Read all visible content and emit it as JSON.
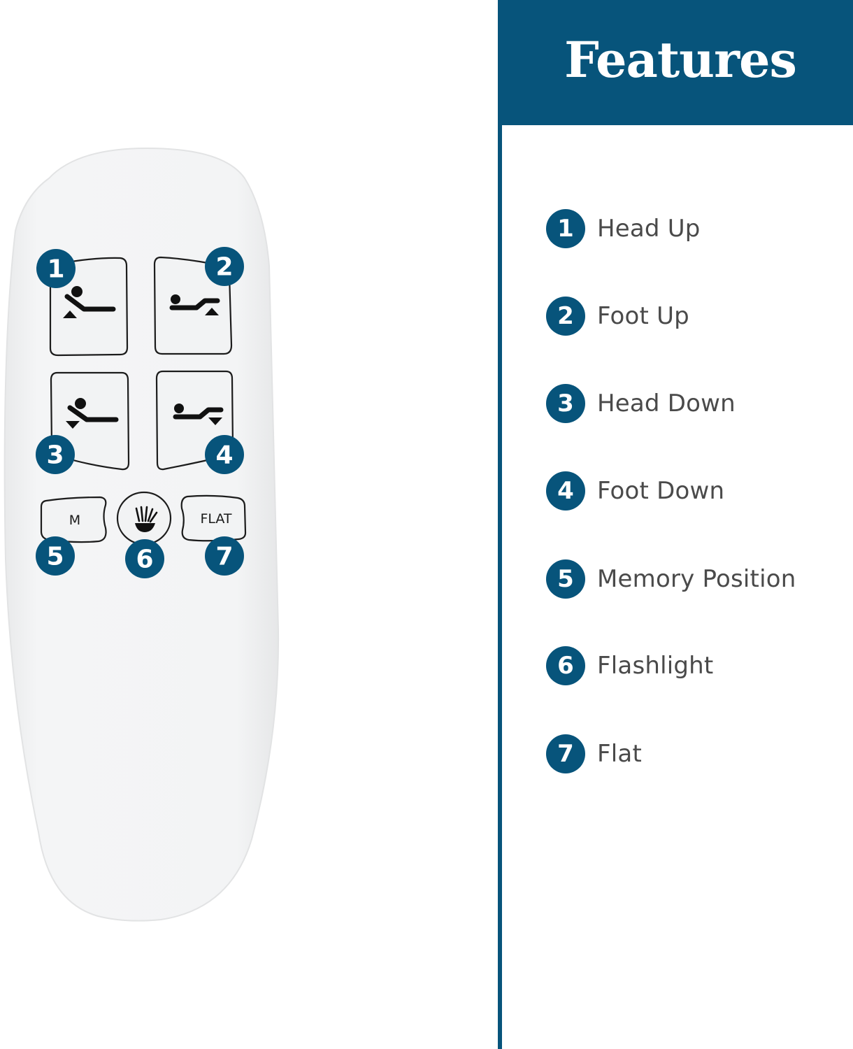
{
  "colors": {
    "brand_blue": "#07547b",
    "label_gray": "#4a4a4a",
    "remote_body": "#f2f3f4"
  },
  "remote": {
    "buttons": [
      {
        "number": "1",
        "icon": "head-up-icon",
        "label": ""
      },
      {
        "number": "2",
        "icon": "foot-up-icon",
        "label": ""
      },
      {
        "number": "3",
        "icon": "head-down-icon",
        "label": ""
      },
      {
        "number": "4",
        "icon": "foot-down-icon",
        "label": ""
      },
      {
        "number": "5",
        "icon": "",
        "label": "M"
      },
      {
        "number": "6",
        "icon": "flashlight-icon",
        "label": ""
      },
      {
        "number": "7",
        "icon": "",
        "label": "FLAT"
      }
    ]
  },
  "features": {
    "title": "Features",
    "items": [
      {
        "number": "1",
        "label": "Head Up"
      },
      {
        "number": "2",
        "label": "Foot Up"
      },
      {
        "number": "3",
        "label": "Head Down"
      },
      {
        "number": "4",
        "label": "Foot Down"
      },
      {
        "number": "5",
        "label": "Memory Position"
      },
      {
        "number": "6",
        "label": "Flashlight"
      },
      {
        "number": "7",
        "label": "Flat"
      }
    ]
  }
}
